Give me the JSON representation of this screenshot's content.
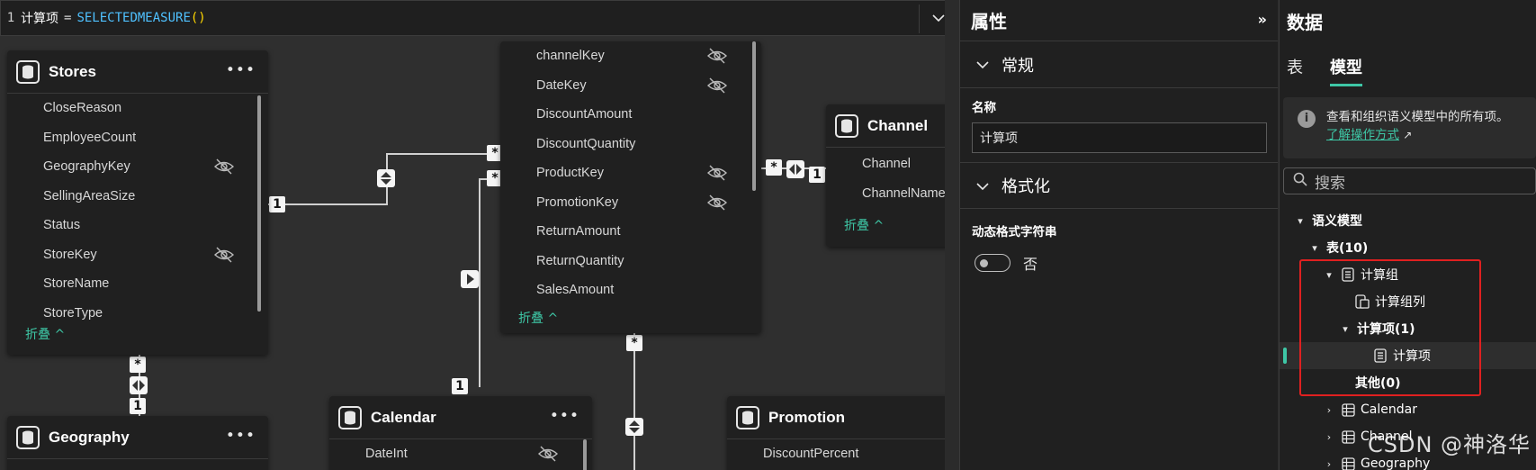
{
  "formula": {
    "line_number": "1",
    "measure": "计算项",
    "operator": "=",
    "function": "SELECTEDMEASURE",
    "parens": "()"
  },
  "tables": {
    "stores": {
      "title": "Stores",
      "fields": [
        "CloseReason",
        "EmployeeCount",
        "GeographyKey",
        "SellingAreaSize",
        "Status",
        "StoreKey",
        "StoreName",
        "StoreType"
      ],
      "collapse": "折叠 ^"
    },
    "sales": {
      "fields": [
        "channelKey",
        "DateKey",
        "DiscountAmount",
        "DiscountQuantity",
        "ProductKey",
        "PromotionKey",
        "ReturnAmount",
        "ReturnQuantity",
        "SalesAmount"
      ],
      "collapse": "折叠 ^"
    },
    "channel": {
      "title": "Channel",
      "fields": [
        "Channel",
        "ChannelName"
      ],
      "collapse": "折叠 ^"
    },
    "geography": {
      "title": "Geography"
    },
    "calendar": {
      "title": "Calendar",
      "fields": [
        "DateInt"
      ]
    },
    "promotion": {
      "title": "Promotion",
      "fields": [
        "DiscountPercent"
      ]
    }
  },
  "relationships": {
    "many": "*",
    "one": "1"
  },
  "properties": {
    "title": "属性",
    "general_section": "常规",
    "name_label": "名称",
    "name_value": "计算项",
    "format_section": "格式化",
    "dynamic_format_label": "动态格式字符串",
    "toggle_value": "否"
  },
  "data_panel": {
    "title": "数据",
    "tabs": [
      "表",
      "模型"
    ],
    "active_tab": "模型",
    "info_text": "查看和组织语义模型中的所有项。",
    "info_link": "了解操作方式",
    "search_placeholder": "搜索",
    "tree": {
      "semantic_model": "语义模型",
      "tables_node": "表(10)",
      "calc_group": "计算组",
      "calc_group_column": "计算组列",
      "calc_items_node": "计算项(1)",
      "calc_item": "计算项",
      "other_node": "其他(0)",
      "calendar": "Calendar",
      "channel": "Channel",
      "geography": "Geography"
    }
  },
  "watermark": "CSDN @神洛华",
  "colors": {
    "accent": "#3ec7a6",
    "highlight_box": "#e02020"
  }
}
